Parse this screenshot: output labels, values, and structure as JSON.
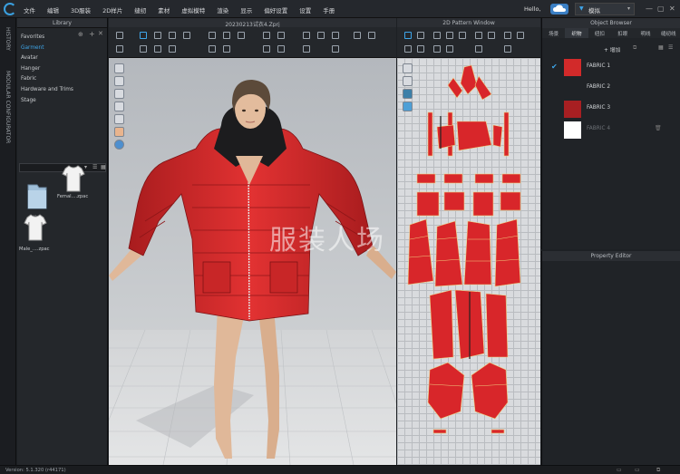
{
  "menubar": {
    "items": [
      "文件",
      "编辑",
      "3D服装",
      "2D样片",
      "缝纫",
      "素材",
      "虚拟模特",
      "渲染",
      "显示",
      "偏好设置",
      "设置",
      "手册"
    ],
    "user_greeting": "Hello,",
    "mode_label": "模拟"
  },
  "history": {
    "tab_history": "HISTORY",
    "tab_modular": "MODULAR CONFIGURATOR"
  },
  "library": {
    "title": "Library",
    "items": [
      "Favorites",
      "Garment",
      "Avatar",
      "Hanger",
      "Fabric",
      "Hardware and Trims",
      "Stage"
    ],
    "selected_index": 1,
    "thumbnails": [
      {
        "label": ".."
      },
      {
        "label": "Femal....zpac"
      },
      {
        "label": "Male_....zpac"
      }
    ]
  },
  "viewport": {
    "title": "20230213试衣4.Zprj"
  },
  "pattern_window": {
    "title": "2D Pattern Window"
  },
  "object_browser": {
    "title": "Object Browser",
    "tabs": [
      "场景",
      "织物",
      "纽扣",
      "扣眼",
      "明线",
      "缝纫线"
    ],
    "active_tab": 1,
    "add_label": "+ 增加",
    "fabrics": [
      {
        "name": "FABRIC 1",
        "color": "#d22a2a",
        "checked": true
      },
      {
        "name": "FABRIC 2",
        "color": "",
        "checked": false
      },
      {
        "name": "FABRIC 3",
        "color": "#a81f22",
        "checked": false
      },
      {
        "name": "FABRIC 4",
        "color": "#ffffff",
        "checked": false
      }
    ]
  },
  "property_editor": {
    "title": "Property Editor"
  },
  "watermark": "服装人场",
  "status": {
    "version": "Version: 5.1.320 (r44171)"
  },
  "colors": {
    "accent": "#3ea6ea",
    "garment_red": "#d22a2a"
  }
}
